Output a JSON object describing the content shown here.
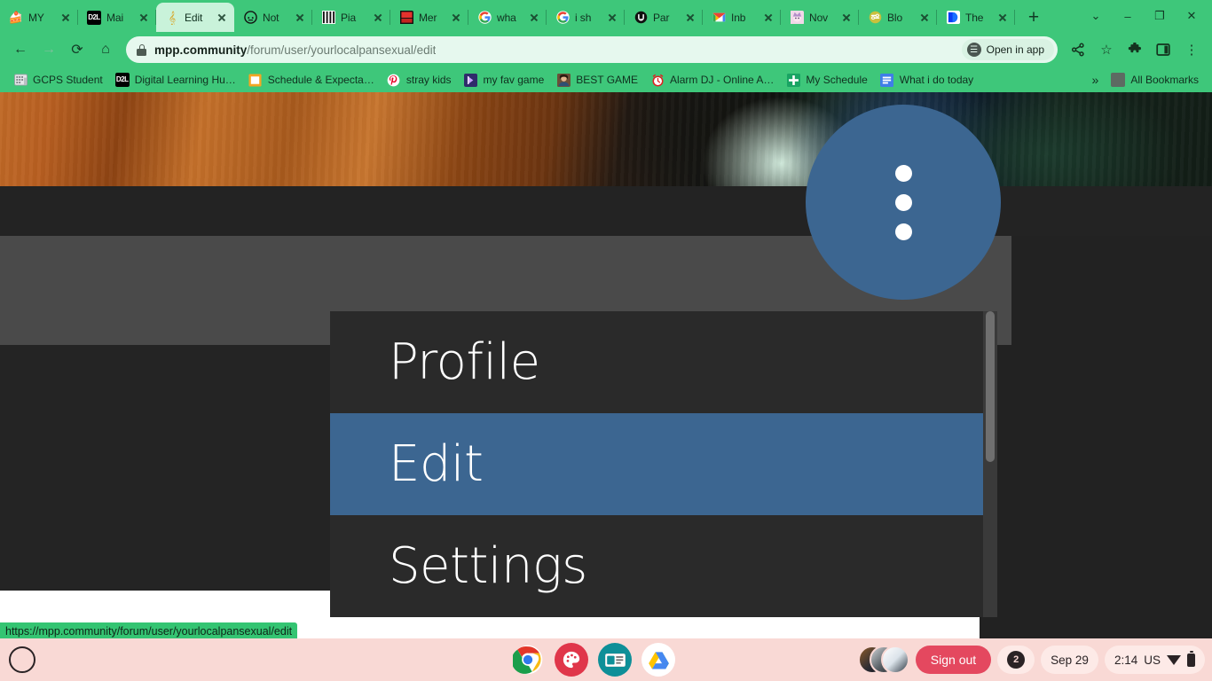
{
  "browser": {
    "tabs": [
      {
        "title": "MY",
        "icon": "cupcake-icon",
        "active": false
      },
      {
        "title": "Mai",
        "icon": "d2l-icon",
        "active": false
      },
      {
        "title": "Edit",
        "icon": "music-note-icon",
        "active": true
      },
      {
        "title": "Not",
        "icon": "skull-icon",
        "active": false
      },
      {
        "title": "Pia",
        "icon": "piano-icon",
        "active": false
      },
      {
        "title": "Mer",
        "icon": "red-book-icon",
        "active": false
      },
      {
        "title": "wha",
        "icon": "google-icon",
        "active": false
      },
      {
        "title": "i sh",
        "icon": "google-icon",
        "active": false
      },
      {
        "title": "Par",
        "icon": "paramount-icon",
        "active": false
      },
      {
        "title": "Inb",
        "icon": "gmail-icon",
        "active": false
      },
      {
        "title": "Nov",
        "icon": "anime-avatar-icon",
        "active": false
      },
      {
        "title": "Blo",
        "icon": "blooket-icon",
        "active": false
      },
      {
        "title": "The",
        "icon": "disney-icon",
        "active": false
      }
    ],
    "new_tab_label": "+",
    "tab_search_label": "⌄",
    "window_minimize_label": "–",
    "window_maximize_label": "❐",
    "window_close_label": "✕",
    "toolbar": {
      "back_label": "←",
      "forward_label": "→",
      "reload_label": "⟳",
      "home_label": "⌂",
      "url_domain": "mpp.community",
      "url_path": "/forum/user/yourlocalpansexual/edit",
      "open_in_app_label": "Open in app",
      "share_label": "‹",
      "bookmark_star_label": "☆",
      "extensions_label": "puzzle",
      "sidepanel_label": "panel",
      "menu_label": "⋮"
    },
    "bookmarks": [
      {
        "label": "GCPS Student",
        "icon": "building-icon",
        "color": "#e9e9ea",
        "glyph": "Ἶ2"
      },
      {
        "label": "Digital Learning Hu…",
        "icon": "d2l-icon",
        "color": "#000000",
        "glyph": "D2L"
      },
      {
        "label": "Schedule & Expecta…",
        "icon": "orange-folder-icon",
        "color": "#f5a623",
        "glyph": ""
      },
      {
        "label": "stray kids",
        "icon": "pinterest-icon",
        "color": "#ffffff",
        "glyph": "Ⓟ"
      },
      {
        "label": "my fav game",
        "icon": "purple-game-icon",
        "color": "#2f2b6b",
        "glyph": ""
      },
      {
        "label": "BEST GAME",
        "icon": "photo-icon",
        "color": "#5a4635",
        "glyph": ""
      },
      {
        "label": "Alarm DJ - Online A…",
        "icon": "alarm-clock-icon",
        "color": "#ffffff",
        "glyph": "⏰"
      },
      {
        "label": "My Schedule",
        "icon": "green-calendar-icon",
        "color": "#19a463",
        "glyph": "✝"
      },
      {
        "label": "What i do today",
        "icon": "blue-docs-icon",
        "color": "#3f7ee8",
        "glyph": "≡"
      }
    ],
    "bookmarks_overflow_label": "»",
    "all_bookmarks_label": "All Bookmarks",
    "all_bookmarks_icon": "folder-icon"
  },
  "page": {
    "banner_alt": "blurred-profile-banner",
    "fab": {
      "name": "more-options-button",
      "icon": "three-dots-vertical-icon"
    },
    "menu": {
      "items": [
        {
          "label": "Profile",
          "selected": false
        },
        {
          "label": "Edit",
          "selected": true
        },
        {
          "label": "Settings",
          "selected": false
        }
      ],
      "accent_color": "#3c6691",
      "background_color": "#2a2a2a"
    },
    "status_url": "https://mpp.community/forum/user/yourlocalpansexual/edit"
  },
  "shelf": {
    "launcher_label": "launcher",
    "apps": [
      {
        "name": "chrome-icon",
        "active": true
      },
      {
        "name": "canvas-paint-icon",
        "active": false
      },
      {
        "name": "media-app-icon",
        "active": false
      },
      {
        "name": "google-drive-icon",
        "active": false
      }
    ],
    "sign_out_label": "Sign out",
    "notification_count": "2",
    "date": "Sep 29",
    "time": "2:14",
    "locale": "US",
    "wifi_icon": "wifi-icon",
    "battery_icon": "battery-icon"
  }
}
